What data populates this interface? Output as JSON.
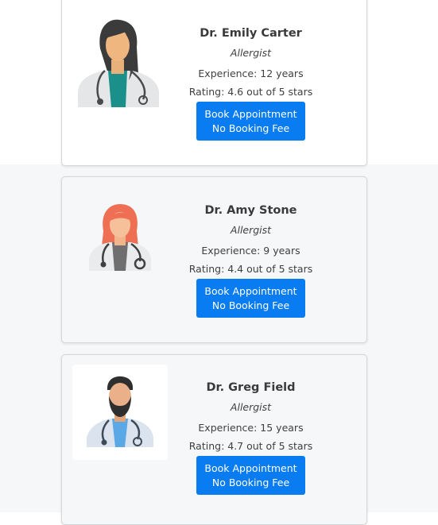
{
  "doctors": [
    {
      "name": "Dr. Emily Carter",
      "specialty": "Allergist",
      "experience": "Experience: 12 years",
      "rating": "Rating: 4.6 out of 5 stars",
      "button_line1": "Book Appointment",
      "button_line2": "No Booking Fee",
      "avatar_icon": "female-doctor-dark-hair-icon"
    },
    {
      "name": "Dr. Amy Stone",
      "specialty": "Allergist",
      "experience": "Experience: 9 years",
      "rating": "Rating: 4.4 out of 5 stars",
      "button_line1": "Book Appointment",
      "button_line2": "No Booking Fee",
      "avatar_icon": "female-doctor-red-hair-icon"
    },
    {
      "name": "Dr. Greg Field",
      "specialty": "Allergist",
      "experience": "Experience: 15 years",
      "rating": "Rating: 4.7 out of 5 stars",
      "button_line1": "Book Appointment",
      "button_line2": "No Booking Fee",
      "avatar_icon": "male-doctor-beard-icon"
    }
  ],
  "colors": {
    "button_blue": "#0a7cf2",
    "page_background": "#f5f7f9",
    "card_border": "#d6d6d6"
  }
}
